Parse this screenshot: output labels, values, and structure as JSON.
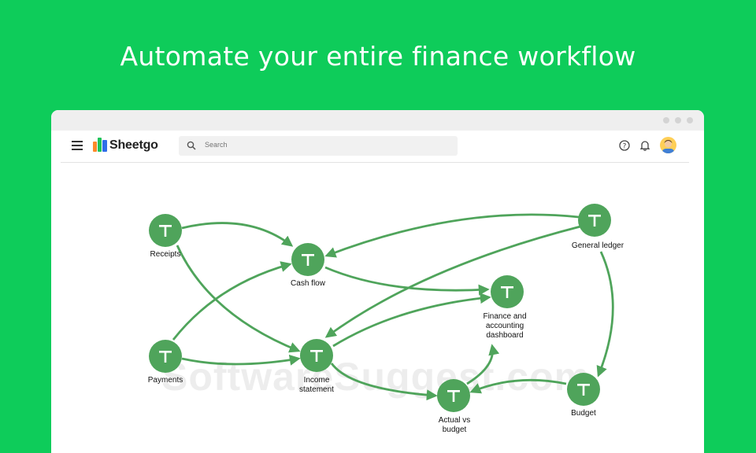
{
  "headline": "Automate your entire finance workflow",
  "app": {
    "name": "Sheetgo",
    "search_placeholder": "Search",
    "icons": [
      "menu-icon",
      "sheetgo-logo-icon",
      "search-icon",
      "help-icon",
      "bell-icon",
      "avatar"
    ]
  },
  "colors": {
    "background": "#0ecc5a",
    "node": "#4fa45b",
    "edge": "#4fa45b"
  },
  "watermark": "SoftwareSuggest.com",
  "nodes": {
    "receipts": "Receipts",
    "cash_flow": "Cash flow",
    "payments": "Payments",
    "income_statement": "Income\nstatement",
    "finance_dashboard": "Finance and\naccounting\ndashboard",
    "actual_vs_budget": "Actual vs\nbudget",
    "general_ledger": "General ledger",
    "budget": "Budget"
  },
  "edges": [
    [
      "receipts",
      "cash_flow"
    ],
    [
      "receipts",
      "income_statement"
    ],
    [
      "payments",
      "cash_flow"
    ],
    [
      "payments",
      "income_statement"
    ],
    [
      "cash_flow",
      "finance_dashboard"
    ],
    [
      "income_statement",
      "finance_dashboard"
    ],
    [
      "income_statement",
      "actual_vs_budget"
    ],
    [
      "general_ledger",
      "cash_flow"
    ],
    [
      "general_ledger",
      "income_statement"
    ],
    [
      "general_ledger",
      "budget"
    ],
    [
      "budget",
      "actual_vs_budget"
    ],
    [
      "actual_vs_budget",
      "finance_dashboard"
    ]
  ]
}
